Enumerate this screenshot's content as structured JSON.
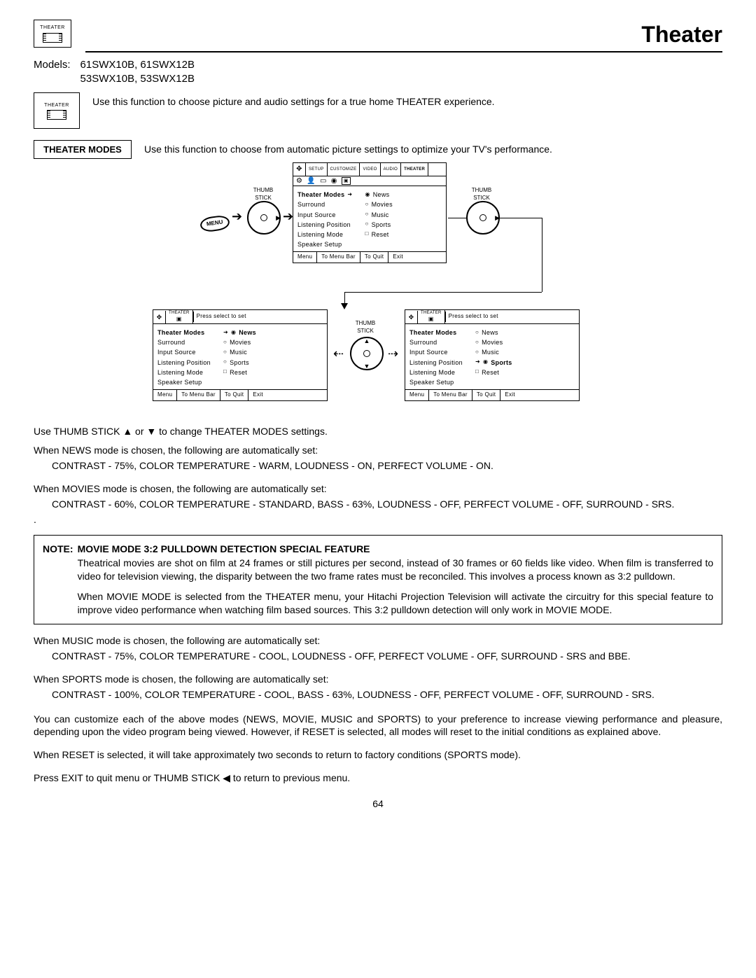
{
  "header": {
    "icon_label": "THEATER",
    "page_title": "Theater"
  },
  "models": {
    "label": "Models:",
    "line1": "61SWX10B, 61SWX12B",
    "line2": "53SWX10B, 53SWX12B"
  },
  "intro": "Use this function to choose picture and audio settings for a true home THEATER experience.",
  "section": {
    "label": "THEATER MODES",
    "desc": "Use this function to choose from automatic picture settings to optimize your TV's performance."
  },
  "diagram": {
    "thumb_label": "THUMB STICK",
    "menu_btn": "MENU",
    "tabs": {
      "setup": "SETUP",
      "customize": "CUSTOMIZE",
      "video": "VIDEO",
      "audio": "AUDIO",
      "theater": "THEATER"
    },
    "press_select": "Press select to set",
    "menu_items": {
      "theater_modes": "Theater Modes",
      "surround": "Surround",
      "input_source": "Input Source",
      "listening_position": "Listening Position",
      "listening_mode": "Listening Mode",
      "speaker_setup": "Speaker Setup"
    },
    "options": {
      "news": "News",
      "movies": "Movies",
      "music": "Music",
      "sports": "Sports",
      "reset": "Reset"
    },
    "footer": {
      "menu": "Menu",
      "to_menu_bar": "To Menu Bar",
      "to_quit": "To Quit",
      "exit": "Exit"
    }
  },
  "instructions": {
    "use_thumb": "Use THUMB STICK ▲ or ▼ to change THEATER MODES settings.",
    "news_head": "When NEWS mode is chosen, the following are automatically set:",
    "news_body": "CONTRAST - 75%, COLOR TEMPERATURE - WARM, LOUDNESS - ON, PERFECT VOLUME - ON.",
    "movies_head": "When MOVIES mode is chosen, the following are automatically set:",
    "movies_body": "CONTRAST - 60%, COLOR TEMPERATURE - STANDARD, BASS - 63%, LOUDNESS - OFF, PERFECT VOLUME - OFF, SURROUND - SRS.",
    "dot": ".",
    "music_head": "When MUSIC mode is chosen, the following are automatically set:",
    "music_body": "CONTRAST - 75%, COLOR TEMPERATURE - COOL, LOUDNESS - OFF, PERFECT VOLUME - OFF, SURROUND - SRS and BBE.",
    "sports_head": "When SPORTS mode is chosen, the following are automatically set:",
    "sports_body": "CONTRAST - 100%, COLOR TEMPERATURE - COOL, BASS - 63%, LOUDNESS - OFF, PERFECT VOLUME - OFF, SURROUND - SRS.",
    "customize": "You can customize each of the above modes (NEWS, MOVIE, MUSIC and SPORTS) to your preference to increase viewing performance and pleasure, depending upon the video program being viewed. However, if RESET is selected, all modes will reset to the initial conditions as explained above.",
    "reset": "When RESET is selected, it will take approximately two seconds to return to factory conditions (SPORTS mode).",
    "exit": "Press EXIT to quit menu or THUMB STICK ◀ to return to previous menu."
  },
  "note": {
    "label": "NOTE:",
    "title": "MOVIE MODE 3:2 PULLDOWN DETECTION SPECIAL FEATURE",
    "p1": "Theatrical movies are shot on film at 24 frames or still pictures per second, instead of 30 frames or 60 fields like video.  When film is transferred to video for television viewing, the disparity between the two frame rates must be reconciled.  This involves a process known as 3:2 pulldown.",
    "p2": "When MOVIE MODE is selected from the THEATER menu, your Hitachi Projection Television will activate the circuitry for this special feature to improve video performance when watching film based sources.  This 3:2 pulldown detection will only work in MOVIE MODE."
  },
  "page_number": "64"
}
